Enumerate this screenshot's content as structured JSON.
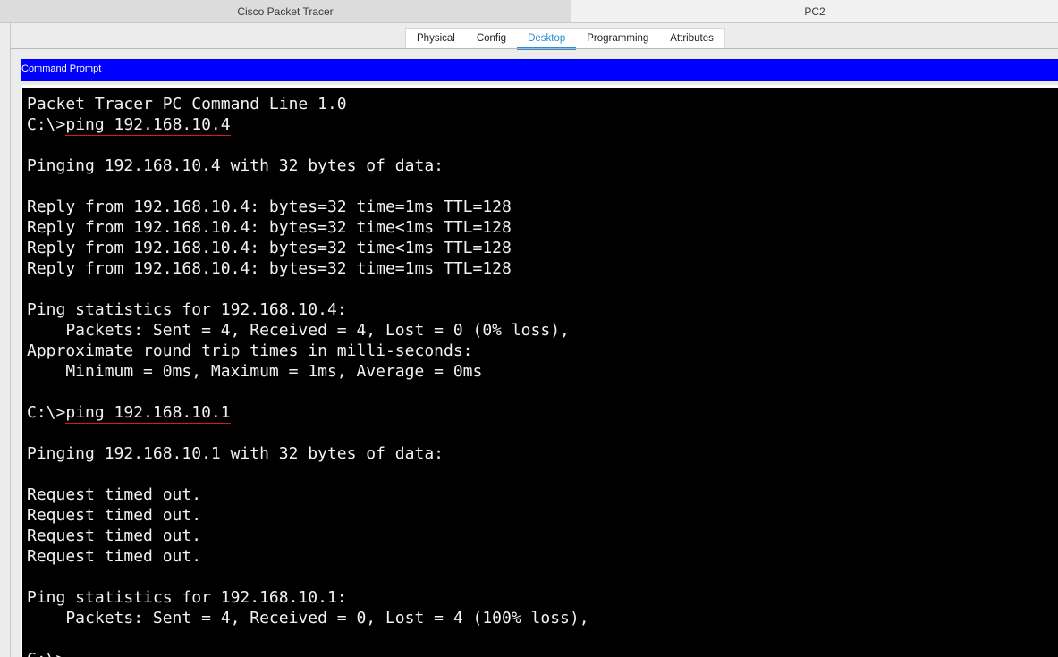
{
  "titlebar": {
    "left_title": "Cisco Packet Tracer",
    "right_title": "PC2"
  },
  "tabs": [
    {
      "label": "Physical",
      "active": false
    },
    {
      "label": "Config",
      "active": false
    },
    {
      "label": "Desktop",
      "active": true
    },
    {
      "label": "Programming",
      "active": false
    },
    {
      "label": "Attributes",
      "active": false
    }
  ],
  "command_prompt": {
    "title": "Command Prompt",
    "prompt": "C:\\>",
    "lines": [
      "Packet Tracer PC Command Line 1.0",
      "",
      "",
      "Pinging 192.168.10.4 with 32 bytes of data:",
      "",
      "Reply from 192.168.10.4: bytes=32 time=1ms TTL=128",
      "Reply from 192.168.10.4: bytes=32 time<1ms TTL=128",
      "Reply from 192.168.10.4: bytes=32 time<1ms TTL=128",
      "Reply from 192.168.10.4: bytes=32 time=1ms TTL=128",
      "",
      "Ping statistics for 192.168.10.4:",
      "    Packets: Sent = 4, Received = 4, Lost = 0 (0% loss),",
      "Approximate round trip times in milli-seconds:",
      "    Minimum = 0ms, Maximum = 1ms, Average = 0ms",
      "",
      "",
      "",
      "Pinging 192.168.10.1 with 32 bytes of data:",
      "",
      "Request timed out.",
      "Request timed out.",
      "Request timed out.",
      "Request timed out.",
      "",
      "Ping statistics for 192.168.10.1:",
      "    Packets: Sent = 4, Received = 0, Lost = 4 (100% loss),",
      "",
      "C:\\>"
    ],
    "commands": [
      {
        "line_index": 1,
        "text": "ping 192.168.10.4"
      },
      {
        "line_index": 15,
        "text": "ping 192.168.10.1"
      }
    ],
    "colors": {
      "header_bg": "#0000fe",
      "terminal_bg": "#000000",
      "terminal_fg": "#f2f2f2",
      "command_underline": "#d21c1c",
      "active_tab": "#2a8fd6"
    }
  }
}
